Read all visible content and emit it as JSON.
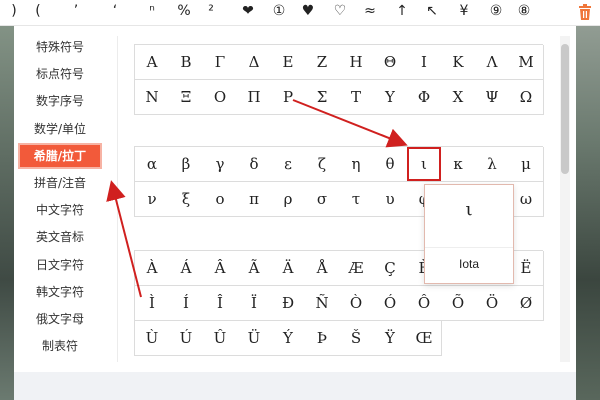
{
  "top_symbols": [
    ")",
    "(",
    "’",
    "‘",
    "ⁿ",
    "%",
    "²",
    "❤",
    "①",
    "♥",
    "♡",
    "≈",
    "↑",
    "↖",
    "¥",
    "⑨",
    "⑧"
  ],
  "categories": [
    "特殊符号",
    "标点符号",
    "数字序号",
    "数学/单位",
    "希腊/拉丁",
    "拼音/注音",
    "中文字符",
    "英文音标",
    "日文字符",
    "韩文字符",
    "俄文字母",
    "制表符"
  ],
  "active_category": "希腊/拉丁",
  "greek_upper": [
    "Α",
    "Β",
    "Γ",
    "Δ",
    "Ε",
    "Ζ",
    "Η",
    "Θ",
    "Ι",
    "Κ",
    "Λ",
    "Μ",
    "Ν",
    "Ξ",
    "Ο",
    "Π",
    "Ρ",
    "Σ",
    "Τ",
    "Υ",
    "Φ",
    "Χ",
    "Ψ",
    "Ω"
  ],
  "greek_lower": [
    "α",
    "β",
    "γ",
    "δ",
    "ε",
    "ζ",
    "η",
    "θ",
    "ι",
    "κ",
    "λ",
    "μ",
    "ν",
    "ξ",
    "ο",
    "π",
    "ρ",
    "σ",
    "τ",
    "υ",
    "φ",
    "χ",
    "ψ",
    "ω"
  ],
  "latin": [
    "À",
    "Á",
    "Â",
    "Ã",
    "Ä",
    "Å",
    "Æ",
    "Ç",
    "È",
    "É",
    "Ê",
    "Ë",
    "Ì",
    "Í",
    "Î",
    "Ï",
    "Ð",
    "Ñ",
    "Ò",
    "Ó",
    "Ô",
    "Õ",
    "Ö",
    "Ø",
    "Ù",
    "Ú",
    "Û",
    "Ü",
    "Ý",
    "Þ",
    "Š",
    "Ÿ",
    "Œ"
  ],
  "tooltip": {
    "char": "ι",
    "name": "Iota"
  },
  "colors": {
    "accent": "#f25a3a",
    "annotation": "#d0201f"
  }
}
